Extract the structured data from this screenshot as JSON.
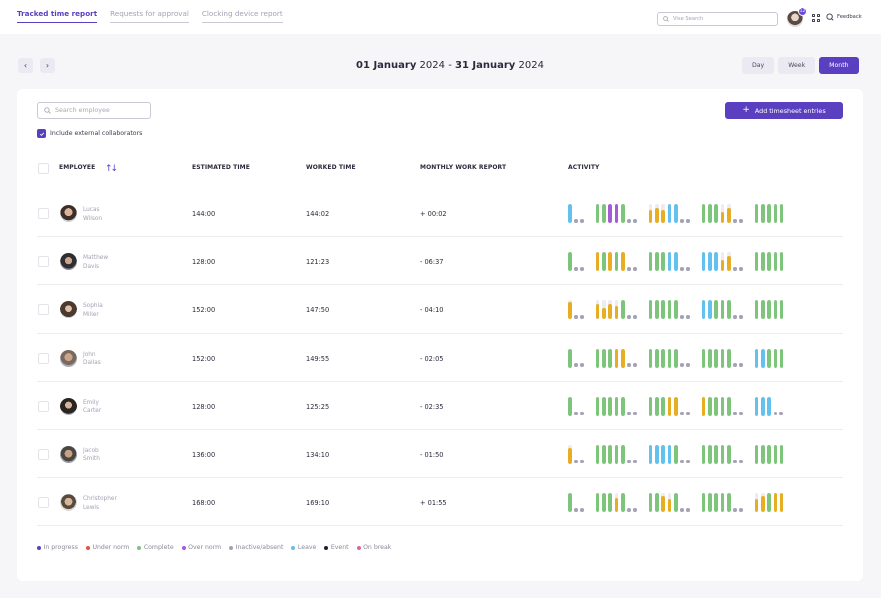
{
  "top_tabs": [
    {
      "label": "Tracked time report",
      "active": true
    },
    {
      "label": "Requests for approval",
      "active": false
    },
    {
      "label": "Clocking device report",
      "active": false
    }
  ],
  "header": {
    "search_placeholder": "Vise Search",
    "notification_count": "12",
    "feedback_label": "Feedback"
  },
  "date_nav": {
    "start_day_month": "01 January",
    "start_year": "2024",
    "separator": "-",
    "end_day_month": "31 January",
    "end_year": "2024",
    "prev_label": "‹",
    "next_label": "›"
  },
  "period": {
    "options": [
      "Day",
      "Week",
      "Month"
    ],
    "selected": "Month"
  },
  "toolbar": {
    "search_placeholder": "Search employee",
    "add_label": "Add timesheet entries",
    "include_external_label": "Include external collaborators",
    "include_external_checked": true
  },
  "table": {
    "columns": {
      "employee": "EMPLOYEE",
      "estimated": "ESTIMATED TIME",
      "worked": "WORKED TIME",
      "monthly": "MONTHLY WORK REPORT",
      "activity": "ACTIVITY"
    },
    "rows": [
      {
        "first": "Lucas",
        "last": "Wilson",
        "estimated": "144:00",
        "worked": "144:02",
        "diff": "+ 00:02",
        "activity": [
          [
            "leave"
          ],
          [
            "complete",
            "complete",
            "over",
            "over",
            "complete"
          ],
          [
            "break-0.7",
            "break-0.8",
            "break-0.7",
            "leave",
            "leave"
          ],
          [
            "complete",
            "complete",
            "complete",
            "break-0.6",
            "break-0.8"
          ],
          [
            "complete",
            "complete",
            "complete",
            "complete",
            "complete"
          ]
        ]
      },
      {
        "first": "Matthew",
        "last": "Davis",
        "estimated": "128:00",
        "worked": "121:23",
        "diff": "- 06:37",
        "activity": [
          [
            "complete"
          ],
          [
            "break",
            "complete",
            "break",
            "complete",
            "break"
          ],
          [
            "complete",
            "complete",
            "complete",
            "leave",
            "leave"
          ],
          [
            "leave",
            "leave",
            "leave",
            "break-0.6",
            "break-0.8"
          ],
          [
            "complete",
            "complete",
            "complete",
            "complete",
            "complete"
          ]
        ]
      },
      {
        "first": "Sophia",
        "last": "Miller",
        "estimated": "152:00",
        "worked": "147:50",
        "diff": "- 04:10",
        "activity": [
          [
            "break-0.9"
          ],
          [
            "break-0.8",
            "break-0.6",
            "break-0.8",
            "break-0.7",
            "complete"
          ],
          [
            "complete",
            "complete",
            "complete",
            "complete",
            "complete"
          ],
          [
            "leave",
            "leave",
            "complete",
            "complete",
            "complete"
          ],
          [
            "complete",
            "complete",
            "complete",
            "complete",
            "complete"
          ]
        ]
      },
      {
        "first": "John",
        "last": "Dallas",
        "estimated": "152:00",
        "worked": "149:55",
        "diff": "- 02:05",
        "activity": [
          [
            "complete"
          ],
          [
            "complete",
            "complete",
            "complete",
            "break",
            "break"
          ],
          [
            "complete",
            "complete",
            "complete",
            "complete",
            "complete"
          ],
          [
            "complete",
            "complete",
            "complete",
            "complete",
            "complete"
          ],
          [
            "leave",
            "leave",
            "complete",
            "complete",
            "complete"
          ]
        ]
      },
      {
        "first": "Emily",
        "last": "Carter",
        "estimated": "128:00",
        "worked": "125:25",
        "diff": "- 02:35",
        "activity": [
          [
            "complete"
          ],
          [
            "complete",
            "complete",
            "complete",
            "complete",
            "complete"
          ],
          [
            "complete",
            "complete",
            "complete",
            "break",
            "break"
          ],
          [
            "break",
            "complete",
            "complete",
            "complete",
            "complete"
          ],
          [
            "leave",
            "leave",
            "leave"
          ]
        ]
      },
      {
        "first": "Jacob",
        "last": "Smith",
        "estimated": "136:00",
        "worked": "134:10",
        "diff": "- 01:50",
        "activity": [
          [
            "break-0.85"
          ],
          [
            "complete",
            "complete",
            "complete",
            "complete",
            "complete"
          ],
          [
            "leave",
            "leave",
            "leave",
            "leave",
            "complete"
          ],
          [
            "complete",
            "complete",
            "complete",
            "complete",
            "complete"
          ],
          [
            "complete",
            "complete",
            "complete",
            "complete",
            "complete"
          ]
        ]
      },
      {
        "first": "Christopher",
        "last": "Lewis",
        "estimated": "168:00",
        "worked": "169:10",
        "diff": "+ 01:55",
        "activity": [
          [
            "complete"
          ],
          [
            "complete",
            "complete",
            "complete",
            "break-0.75",
            "complete"
          ],
          [
            "complete",
            "complete",
            "break-0.85",
            "break-0.7",
            "complete"
          ],
          [
            "complete",
            "complete",
            "complete",
            "complete",
            "complete"
          ],
          [
            "break-0.7",
            "break-0.85",
            "complete",
            "break",
            "break"
          ]
        ]
      }
    ]
  },
  "legend": [
    {
      "label": "In progress",
      "color": "#5a3fc0"
    },
    {
      "label": "Under norm",
      "color": "#e0533f"
    },
    {
      "label": "Complete",
      "color": "#7dc57a"
    },
    {
      "label": "Over norm",
      "color": "#a55ad6"
    },
    {
      "label": "Inactive/absent",
      "color": "#a3a3b5"
    },
    {
      "label": "Leave",
      "color": "#62c1ee"
    },
    {
      "label": "Event",
      "color": "#1f1f33"
    },
    {
      "label": "On break",
      "color": "#d9679c"
    }
  ],
  "status_colors": {
    "complete": "#7dc57a",
    "over": "#a55ad6",
    "leave": "#62c1ee",
    "break": "#e8ad22",
    "accent": "#5a3fc0"
  }
}
